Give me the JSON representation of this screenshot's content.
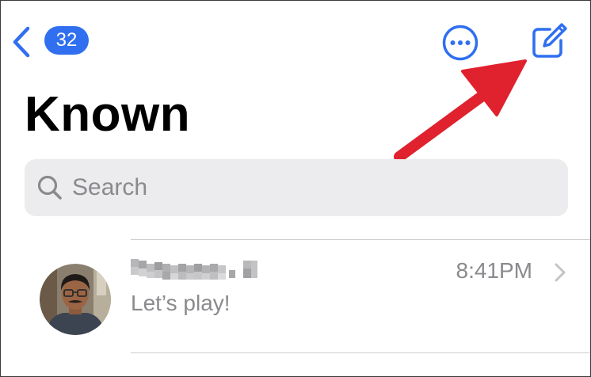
{
  "nav": {
    "back_icon": "chevron-left-icon",
    "unread_count": "32",
    "more_icon": "ellipsis-circle-icon",
    "compose_icon": "square-and-pencil-icon",
    "accent_color": "#2f6ff0"
  },
  "page": {
    "title": "Known"
  },
  "search": {
    "icon": "magnifying-glass-icon",
    "placeholder": "Search",
    "value": ""
  },
  "conversations": [
    {
      "sender": "",
      "sender_redacted": true,
      "time": "8:41PM",
      "preview": "Let’s play!",
      "avatar": "contact-photo",
      "disclosure_icon": "chevron-right-icon"
    }
  ],
  "annotation": {
    "type": "arrow",
    "color": "#e0212e",
    "points_to": "compose-button"
  }
}
